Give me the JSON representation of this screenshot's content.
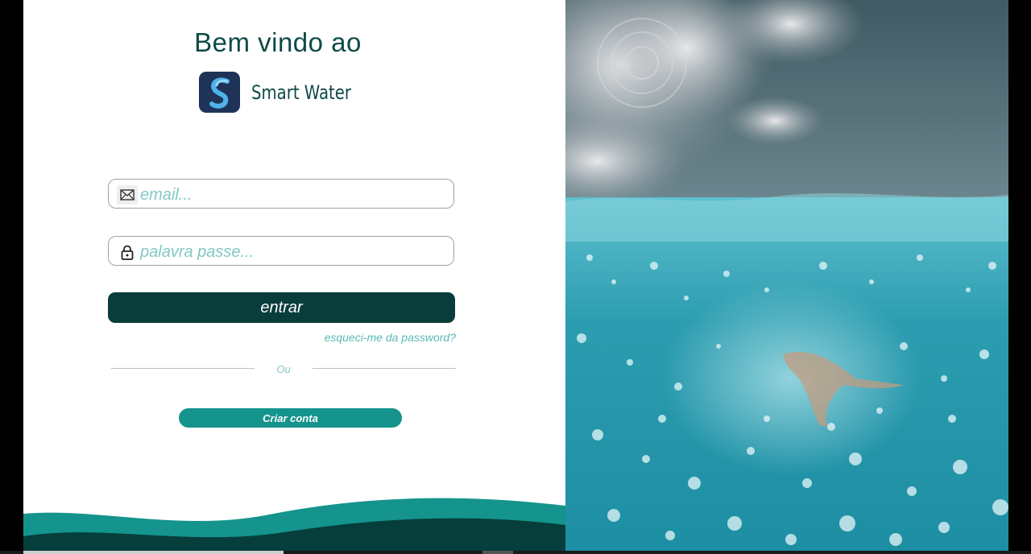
{
  "header": {
    "welcome": "Bem vindo ao",
    "app_name": "Smart Water",
    "logo_icon": "smart-water-logo-icon"
  },
  "form": {
    "email": {
      "value": "",
      "placeholder": "email...",
      "icon": "envelope-icon"
    },
    "password": {
      "value": "",
      "placeholder": "palavra passe...",
      "icon": "lock-icon"
    },
    "login_label": "entrar",
    "forgot_label": "esqueci-me da password?",
    "divider_label": "Ou",
    "create_account_label": "Criar conta"
  },
  "colors": {
    "primary_dark": "#093d3b",
    "accent_teal": "#14948c",
    "logo_bg": "#1f3358",
    "placeholder": "#82c8c6"
  },
  "hero_image": {
    "subject": "underwater-swimmer-photo"
  }
}
